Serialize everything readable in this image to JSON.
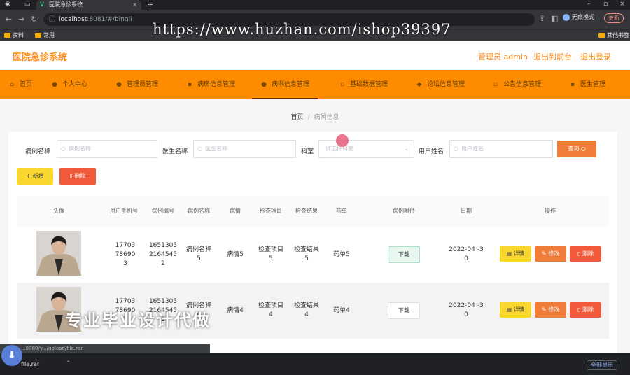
{
  "browser": {
    "tab_title": "医院急诊系统",
    "url_host": "localhost",
    "url_rest": ":8081/#/bingli",
    "profile_label": "无痕模式",
    "update_label": "更新",
    "bookmarks": [
      "资料",
      "常用"
    ],
    "bookmark_other": "其他书签",
    "overlay_url": "https://www.huzhan.com/ishop39397"
  },
  "app": {
    "title": "医院急诊系统",
    "header_links": [
      "管理员 admin",
      "退出到前台",
      "退出登录"
    ]
  },
  "menu": {
    "items": [
      {
        "label": "首页",
        "icon": "home-icon"
      },
      {
        "label": "个人中心",
        "icon": "user-icon"
      },
      {
        "label": "管理员管理",
        "icon": "user-icon"
      },
      {
        "label": "病房信息管理",
        "icon": "bed-icon"
      },
      {
        "label": "病例信息管理",
        "icon": "file-icon"
      },
      {
        "label": "基础数据管理",
        "icon": "grid-icon"
      },
      {
        "label": "论坛信息管理",
        "icon": "chat-icon"
      },
      {
        "label": "公告信息管理",
        "icon": "bell-icon"
      },
      {
        "label": "医生管理",
        "icon": "doctor-icon"
      }
    ],
    "active_index": 4
  },
  "breadcrumb": {
    "home": "首页",
    "current": "病例信息"
  },
  "filters": {
    "case_name_label": "病例名称",
    "case_name_placeholder": "病例名称",
    "doctor_label": "医生名称",
    "doctor_placeholder": "医生名称",
    "dept_label": "科室",
    "dept_placeholder": "请选择科室",
    "user_label": "用户姓名",
    "user_placeholder": "用户姓名",
    "query_label": "查询"
  },
  "actions": {
    "add_label": "+ 新增",
    "delete_label": "删除"
  },
  "table": {
    "headers": [
      "头像",
      "用户手机号",
      "病例编号",
      "病例名称",
      "病情",
      "检查项目",
      "检查结果",
      "药单",
      "病例附件",
      "日期",
      "操作"
    ],
    "rows": [
      {
        "phone": "17703786903",
        "case_no": "16513052164545 2",
        "case_name": "病例名称 5",
        "illness": "病情5",
        "item": "检查项目 5",
        "result": "检查结果 5",
        "drug": "药单5",
        "attach": "下载",
        "date": "2022-04 -30"
      },
      {
        "phone": "17703786902",
        "case_no": "16513052164545 1",
        "case_name": "病例名称 4",
        "illness": "病情4",
        "item": "检查项目 4",
        "result": "检查结果 4",
        "drug": "药单4",
        "attach": "下载",
        "date": "2022-04 -30"
      }
    ],
    "op_labels": {
      "detail": "详情",
      "edit": "修改",
      "delete": "删除"
    }
  },
  "overlay_text": "专业毕业设计代做",
  "download": {
    "file": "file.rar",
    "status_url": "...8080/y.../upload/file.rar",
    "show_all": "全部显示"
  },
  "colors": {
    "accent": "#ff8c00",
    "title": "#ff8c1a",
    "query": "#f07c3a",
    "danger": "#f05a3a",
    "warn": "#f9d72e"
  }
}
